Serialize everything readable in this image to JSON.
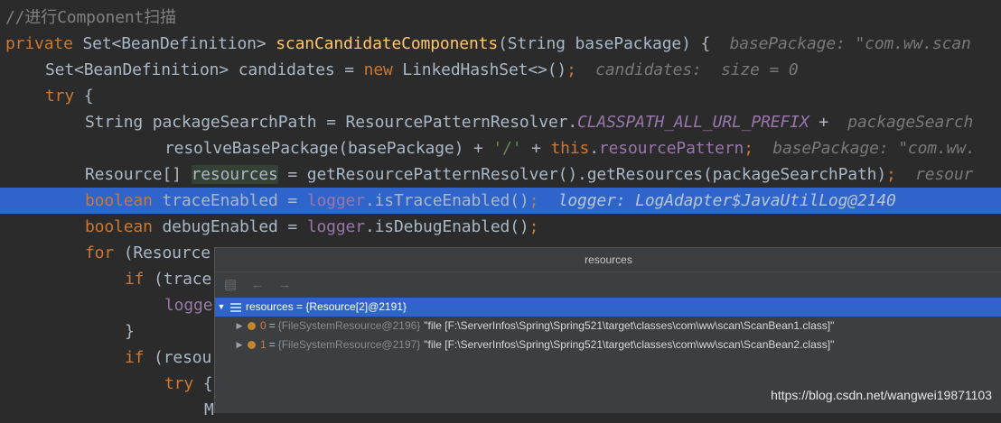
{
  "code": {
    "comment": "//进行Component扫描",
    "l1": {
      "kw": "private",
      "type": " Set<BeanDefinition> ",
      "fn": "scanCandidateComponents",
      "rest": "(String basePackage) {",
      "hint": "basePackage: \"com.ww.scan"
    },
    "l2": {
      "a": "Set<BeanDefinition> candidates = ",
      "kw": "new",
      "b": " LinkedHashSet<>()",
      "semi": ";",
      "hint": "candidates:  size = 0"
    },
    "l3": {
      "kw": "try",
      "rest": " {"
    },
    "l4": {
      "a": "String packageSearchPath = ResourcePatternResolver.",
      "const": "CLASSPATH_ALL_URL_PREFIX",
      "b": " +",
      "hint": "packageSearch"
    },
    "l5": {
      "a": "resolveBasePackage(basePackage) + ",
      "str": "'/'",
      "b": " + ",
      "kw": "this",
      "dot": ".",
      "fld": "resourcePattern",
      "semi": ";",
      "hint": "basePackage: \"com.ww."
    },
    "l6": {
      "a": "Resource[] ",
      "var": "resources",
      "b": " = getResourcePatternResolver().getResources(packageSearchPath)",
      "semi": ";",
      "hint": "resour"
    },
    "l7": {
      "kw": "boolean",
      "a": " traceEnabled = ",
      "fld": "logger",
      "b": ".isTraceEnabled()",
      "semi": ";",
      "hint": "logger: LogAdapter$JavaUtilLog@2140"
    },
    "l8": {
      "kw": "boolean",
      "a": " debugEnabled = ",
      "fld": "logger",
      "b": ".isDebugEnabled()",
      "semi": ";"
    },
    "l9": {
      "kw": "for",
      "a": " (Resource"
    },
    "l10": {
      "kw": "if",
      "a": " (trace"
    },
    "l11": {
      "fld": "logge"
    },
    "l12": {
      "a": "}"
    },
    "l13": {
      "kw": "if",
      "a": " (resou"
    },
    "l14": {
      "kw": "try",
      "a": " {"
    },
    "l15": {
      "a": "M"
    }
  },
  "popup": {
    "title": "resources",
    "toolbar": [
      {
        "icon": "copy-value-icon",
        "glyph": "▤"
      },
      {
        "icon": "back-arrow-icon",
        "glyph": "←"
      },
      {
        "icon": "forward-arrow-icon",
        "glyph": "→"
      }
    ],
    "root": {
      "arrow": "▼",
      "label": "resources = {Resource[2]@2191}"
    },
    "items": [
      {
        "arrow": "▶",
        "index": "0",
        "eq": "=",
        "type": "{FileSystemResource@2196}",
        "value": "\"file [F:\\ServerInfos\\Spring\\Spring521\\target\\classes\\com\\ww\\scan\\ScanBean1.class]\""
      },
      {
        "arrow": "▶",
        "index": "1",
        "eq": "=",
        "type": "{FileSystemResource@2197}",
        "value": "\"file [F:\\ServerInfos\\Spring\\Spring521\\target\\classes\\com\\ww\\scan\\ScanBean2.class]\""
      }
    ]
  },
  "watermark": "https://blog.csdn.net/wangwei19871103",
  "colors": {
    "background": "#2b2b2b",
    "keyword": "#cc7832",
    "function": "#ffc66d",
    "field": "#9876aa",
    "selection": "#2f65ca"
  }
}
